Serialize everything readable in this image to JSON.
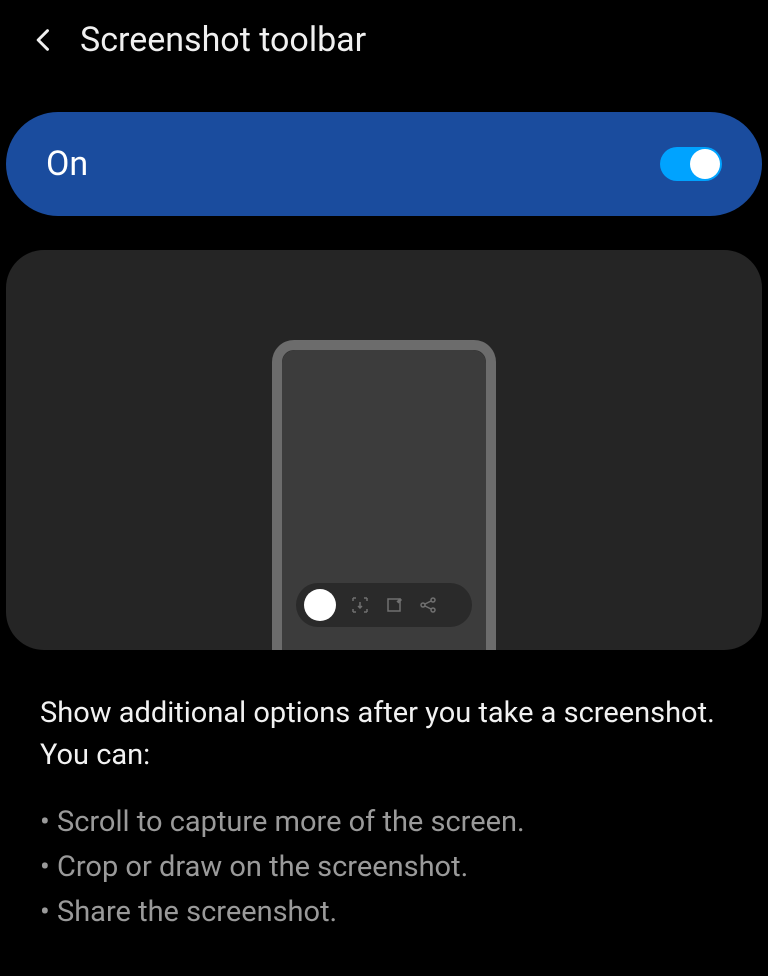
{
  "header": {
    "title": "Screenshot toolbar"
  },
  "toggle": {
    "label": "On",
    "state": true
  },
  "description": {
    "intro": "Show additional options after you take a screenshot. You can:",
    "bullets": [
      "Scroll to capture more of the screen.",
      "Crop or draw on the screenshot.",
      "Share the screenshot."
    ]
  }
}
